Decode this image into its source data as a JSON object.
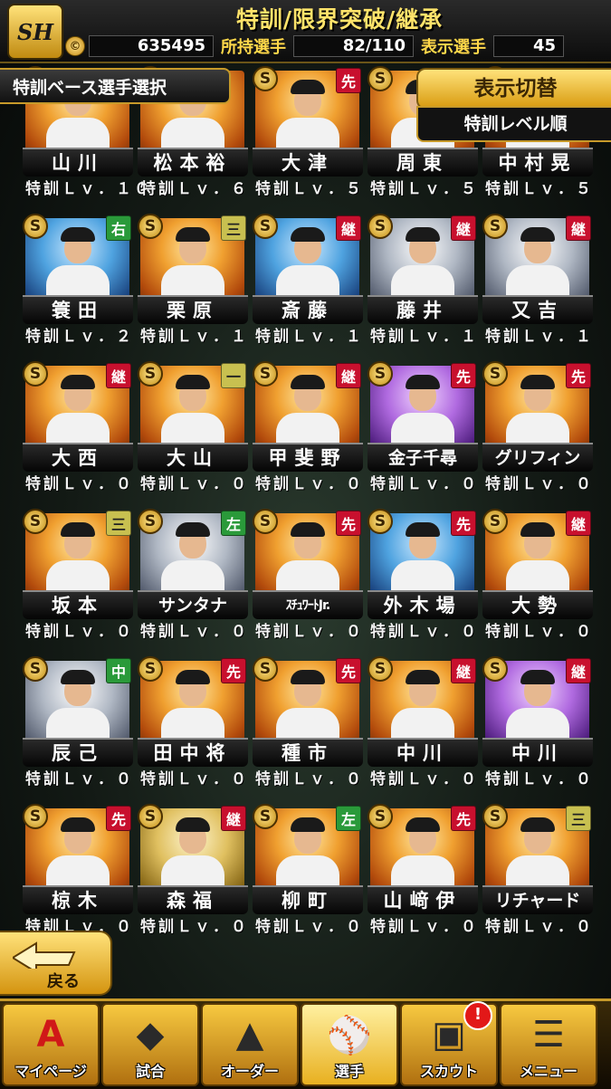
{
  "header": {
    "logo_text": "SH",
    "title": "特訓/限界突破/継承",
    "coin_icon": "©",
    "coins": "635495",
    "owned_label": "所持選手",
    "owned_value": "82/110",
    "display_label": "表示選手",
    "display_value": "45"
  },
  "banner": {
    "selection_label": "特訓ベース選手選択"
  },
  "sort": {
    "switch_label": "表示切替",
    "current_order": "特訓レベル順"
  },
  "colors": {
    "pos_先": "#c8102e",
    "pos_継": "#c8102e",
    "pos_右": "#2a9a3a",
    "pos_左": "#2a9a3a",
    "pos_中": "#2a9a3a",
    "pos_三": "#c8c050",
    "pos_一": "#c8c050"
  },
  "cards": [
    {
      "name": "山川",
      "level": "特訓Ｌｖ．１０",
      "pos": "",
      "theme": "",
      "tight": false
    },
    {
      "name": "松本裕",
      "level": "特訓Ｌｖ．６",
      "pos": "",
      "theme": "",
      "tight": false
    },
    {
      "name": "大津",
      "level": "特訓Ｌｖ．５",
      "pos": "先",
      "theme": "",
      "tight": false
    },
    {
      "name": "周東",
      "level": "特訓Ｌｖ．５",
      "pos": "",
      "theme": "",
      "tight": false
    },
    {
      "name": "中村晃",
      "level": "特訓Ｌｖ．５",
      "pos": "",
      "theme": "",
      "tight": false
    },
    {
      "name": "簑田",
      "level": "特訓Ｌｖ．２",
      "pos": "右",
      "theme": "blue",
      "tight": false
    },
    {
      "name": "栗原",
      "level": "特訓Ｌｖ．１",
      "pos": "三",
      "theme": "",
      "tight": false
    },
    {
      "name": "斎藤",
      "level": "特訓Ｌｖ．１",
      "pos": "継",
      "theme": "blue",
      "tight": false
    },
    {
      "name": "藤井",
      "level": "特訓Ｌｖ．１",
      "pos": "継",
      "theme": "silver",
      "tight": false
    },
    {
      "name": "又吉",
      "level": "特訓Ｌｖ．１",
      "pos": "継",
      "theme": "silver",
      "tight": false
    },
    {
      "name": "大西",
      "level": "特訓Ｌｖ．０",
      "pos": "継",
      "theme": "",
      "tight": false
    },
    {
      "name": "大山",
      "level": "特訓Ｌｖ．０",
      "pos": "一",
      "theme": "",
      "tight": false
    },
    {
      "name": "甲斐野",
      "level": "特訓Ｌｖ．０",
      "pos": "継",
      "theme": "",
      "tight": false
    },
    {
      "name": "金子千尋",
      "level": "特訓Ｌｖ．０",
      "pos": "先",
      "theme": "purple",
      "tight": true
    },
    {
      "name": "グリフィン",
      "level": "特訓Ｌｖ．０",
      "pos": "先",
      "theme": "",
      "tight": true
    },
    {
      "name": "坂本",
      "level": "特訓Ｌｖ．０",
      "pos": "三",
      "theme": "",
      "tight": false
    },
    {
      "name": "サンタナ",
      "level": "特訓Ｌｖ．０",
      "pos": "左",
      "theme": "silver",
      "tight": true
    },
    {
      "name": "ｽﾁｭﾜｰﾄJr.",
      "level": "特訓Ｌｖ．０",
      "pos": "先",
      "theme": "",
      "tight": "x"
    },
    {
      "name": "外木場",
      "level": "特訓Ｌｖ．０",
      "pos": "先",
      "theme": "blue",
      "tight": false
    },
    {
      "name": "大勢",
      "level": "特訓Ｌｖ．０",
      "pos": "継",
      "theme": "",
      "tight": false
    },
    {
      "name": "辰己",
      "level": "特訓Ｌｖ．０",
      "pos": "中",
      "theme": "silver",
      "tight": false
    },
    {
      "name": "田中将",
      "level": "特訓Ｌｖ．０",
      "pos": "先",
      "theme": "",
      "tight": false
    },
    {
      "name": "種市",
      "level": "特訓Ｌｖ．０",
      "pos": "先",
      "theme": "",
      "tight": false
    },
    {
      "name": "中川",
      "level": "特訓Ｌｖ．０",
      "pos": "継",
      "theme": "",
      "tight": false
    },
    {
      "name": "中川",
      "level": "特訓Ｌｖ．０",
      "pos": "継",
      "theme": "purple",
      "tight": false
    },
    {
      "name": "椋木",
      "level": "特訓Ｌｖ．０",
      "pos": "先",
      "theme": "",
      "tight": false
    },
    {
      "name": "森福",
      "level": "特訓Ｌｖ．０",
      "pos": "継",
      "theme": "gold",
      "tight": false
    },
    {
      "name": "柳町",
      "level": "特訓Ｌｖ．０",
      "pos": "左",
      "theme": "",
      "tight": false
    },
    {
      "name": "山﨑伊",
      "level": "特訓Ｌｖ．０",
      "pos": "先",
      "theme": "",
      "tight": false
    },
    {
      "name": "リチャード",
      "level": "特訓Ｌｖ．０",
      "pos": "三",
      "theme": "",
      "tight": true
    }
  ],
  "back": {
    "label": "戻る"
  },
  "nav": [
    {
      "label": "マイページ",
      "icon": "A",
      "icon_name": "mypage-icon"
    },
    {
      "label": "試合",
      "icon": "◆",
      "icon_name": "stadium-icon"
    },
    {
      "label": "オーダー",
      "icon": "▲",
      "icon_name": "field-icon"
    },
    {
      "label": "選手",
      "icon": "⚾",
      "icon_name": "player-icon"
    },
    {
      "label": "スカウト",
      "icon": "▣",
      "icon_name": "scout-book-icon"
    },
    {
      "label": "メニュー",
      "icon": "☰",
      "icon_name": "menu-icon"
    }
  ],
  "scout_badge": "!"
}
